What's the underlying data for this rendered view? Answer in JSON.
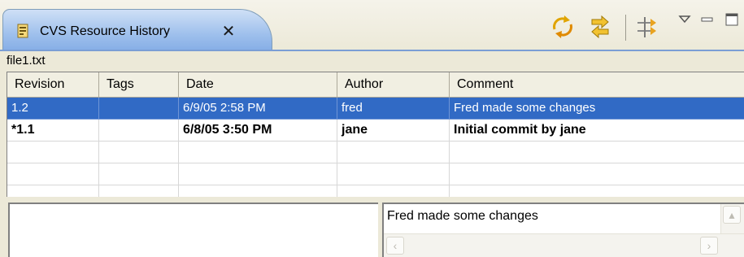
{
  "view": {
    "title": "CVS Resource History",
    "close_symbol": "✕",
    "icon": "history-view-icon"
  },
  "toolbar": {
    "buttons": [
      {
        "name": "refresh-button",
        "icon": "refresh-sync-icon"
      },
      {
        "name": "link-with-editor-button",
        "icon": "link-editor-icon"
      },
      {
        "name": "compare-mode-button",
        "icon": "compare-icon"
      }
    ],
    "view_menu_icon": "chevron-down-icon",
    "minimize_icon": "minimize-icon",
    "maximize_icon": "maximize-icon"
  },
  "file": {
    "name": "file1.txt"
  },
  "table": {
    "columns": [
      "Revision",
      "Tags",
      "Date",
      "Author",
      "Comment"
    ],
    "rows": [
      {
        "revision": "1.2",
        "tags": "",
        "date": "6/9/05 2:58 PM",
        "author": "fred",
        "comment": "Fred made some changes",
        "selected": true,
        "bold": false
      },
      {
        "revision": "*1.1",
        "tags": "",
        "date": "6/8/05 3:50 PM",
        "author": "jane",
        "comment": "Initial commit by jane",
        "selected": false,
        "bold": true
      }
    ]
  },
  "detail": {
    "comment": "Fred made some changes"
  },
  "colors": {
    "selection": "#316ac5",
    "tab_active": "#9fc0ec",
    "background": "#ece9d8"
  }
}
